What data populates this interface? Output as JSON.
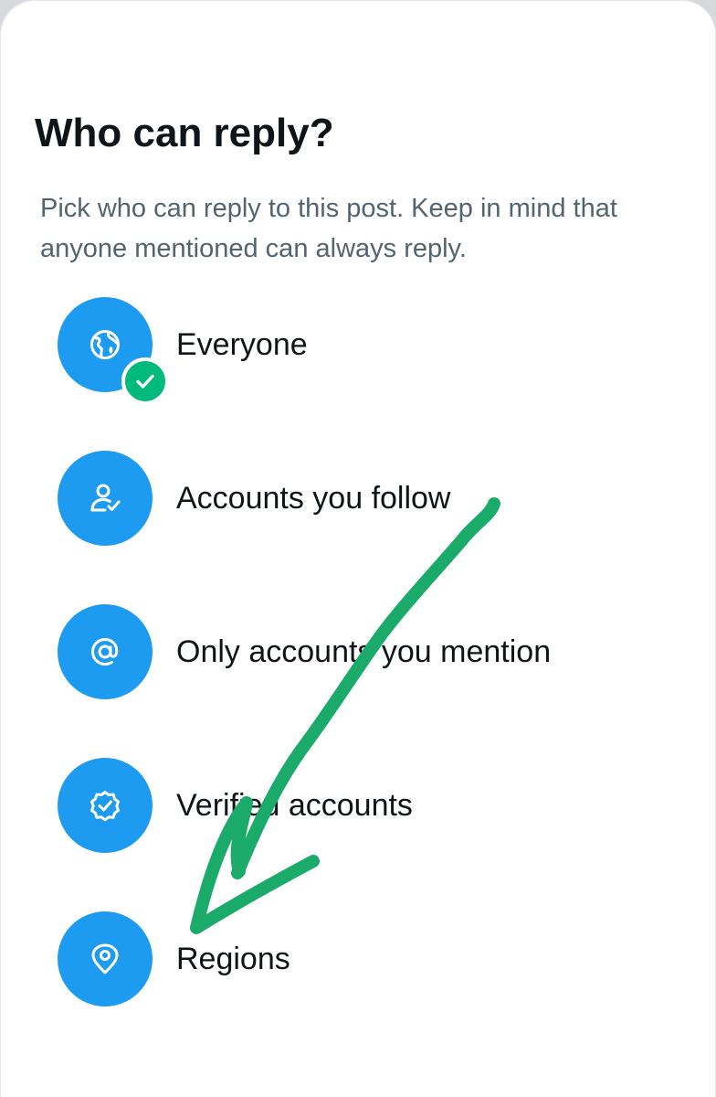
{
  "dialog": {
    "title": "Who can reply?",
    "subtitle": "Pick who can reply to this post. Keep in mind that anyone mentioned can always reply."
  },
  "options": [
    {
      "label": "Everyone",
      "icon": "globe-icon",
      "selected": true
    },
    {
      "label": "Accounts you follow",
      "icon": "person-check-icon",
      "selected": false
    },
    {
      "label": "Only accounts you mention",
      "icon": "at-sign-icon",
      "selected": false
    },
    {
      "label": "Verified accounts",
      "icon": "verified-badge-icon",
      "selected": false
    },
    {
      "label": "Regions",
      "icon": "location-pin-icon",
      "selected": false
    }
  ],
  "colors": {
    "accent": "#1d9bf0",
    "selected_badge": "#00ba7c",
    "annotation_stroke": "#1aab6b",
    "title_text": "#0f1419",
    "subtitle_text": "#536471"
  },
  "annotation": {
    "type": "hand-drawn-arrow",
    "points_to": "Regions"
  }
}
